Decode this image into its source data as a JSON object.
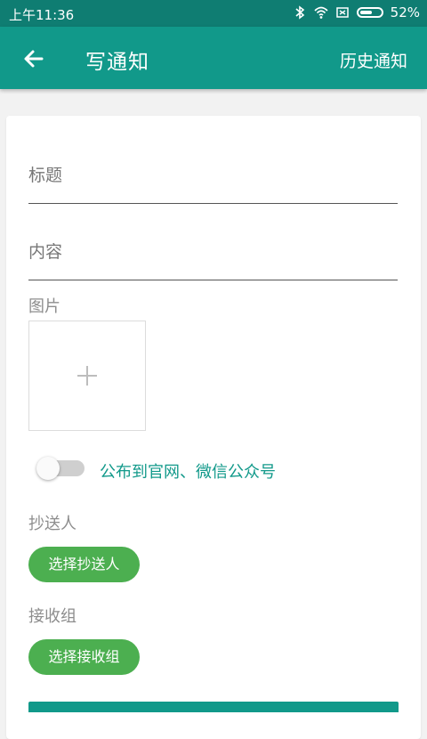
{
  "status_bar": {
    "time": "上午11:36",
    "battery_percent": "52%",
    "battery_level": 0.52,
    "icons": [
      "bluetooth-icon",
      "wifi-icon",
      "sim-off-icon",
      "battery-icon"
    ]
  },
  "app_bar": {
    "title": "写通知",
    "history": "历史通知",
    "color": "#11998a"
  },
  "form": {
    "title_placeholder": "标题",
    "content_placeholder": "内容",
    "image_label": "图片",
    "publish_label": "公布到官网、微信公众号",
    "publish_enabled": false,
    "cc_label": "抄送人",
    "cc_button": "选择抄送人",
    "group_label": "接收组",
    "group_button": "选择接收组"
  },
  "colors": {
    "primary": "#11998a",
    "status": "#0f7d72",
    "chip": "#4caf50"
  }
}
